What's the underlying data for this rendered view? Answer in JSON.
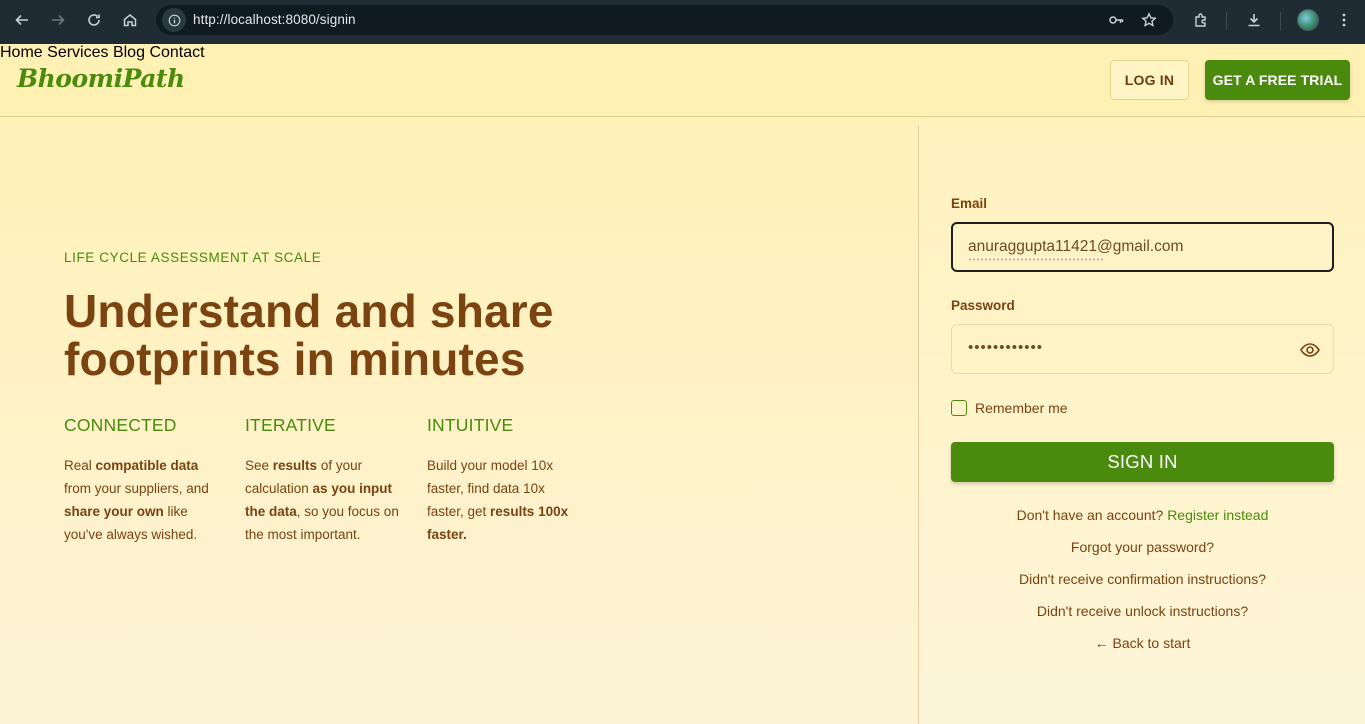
{
  "browser": {
    "url": "http://localhost:8080/signin"
  },
  "header": {
    "logo": "BhoomiPath",
    "nav": [
      "Home",
      "Services",
      "Blog",
      "Contact"
    ],
    "login_label": "LOG IN",
    "trial_label": "GET A FREE TRIAL"
  },
  "hero": {
    "eyebrow": "LIFE CYCLE ASSESSMENT AT SCALE",
    "headline_line1": "Understand and share",
    "headline_line2": "footprints in minutes",
    "features": [
      {
        "title": "CONNECTED",
        "parts": [
          {
            "t": "Real ",
            "b": false
          },
          {
            "t": "compatible data",
            "b": true
          },
          {
            "t": " from your suppliers, and ",
            "b": false
          },
          {
            "t": "share your own",
            "b": true
          },
          {
            "t": " like you've always wished.",
            "b": false
          }
        ]
      },
      {
        "title": "ITERATIVE",
        "parts": [
          {
            "t": "See ",
            "b": false
          },
          {
            "t": "results",
            "b": true
          },
          {
            "t": " of your calculation ",
            "b": false
          },
          {
            "t": "as you input the data",
            "b": true
          },
          {
            "t": ", so you focus on the most important.",
            "b": false
          }
        ]
      },
      {
        "title": "INTUITIVE",
        "parts": [
          {
            "t": "Build your model 10x faster, find data 10x faster, get ",
            "b": false
          },
          {
            "t": "results 100x faster.",
            "b": true
          }
        ]
      }
    ]
  },
  "form": {
    "email_label": "Email",
    "email_value": "anuraggupta11421@gmail.com",
    "password_label": "Password",
    "password_value": "••••••••••••",
    "remember_label": "Remember me",
    "signin_label": "SIGN IN",
    "no_account_text": "Don't have an account?",
    "register_link": "Register instead",
    "forgot_link": "Forgot your password?",
    "confirm_link": "Didn't receive confirmation instructions?",
    "unlock_link": "Didn't receive unlock instructions?",
    "back_link": "← Back to start"
  },
  "colors": {
    "brand_green": "#4a8a0c",
    "brand_brown": "#7a4310",
    "background": "#fdf3c4"
  }
}
